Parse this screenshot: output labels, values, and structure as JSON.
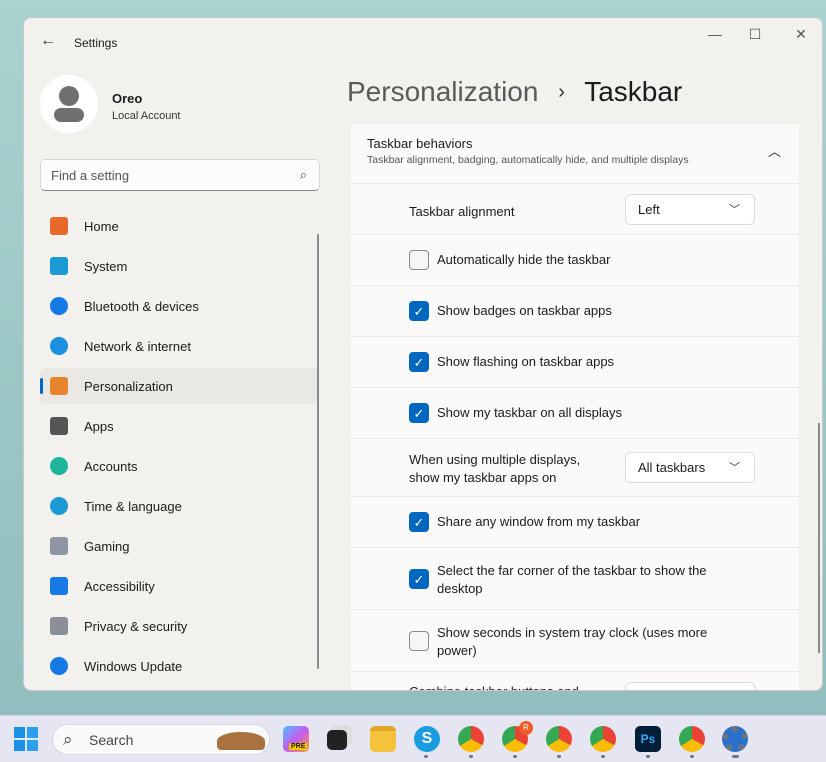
{
  "window": {
    "title": "Settings",
    "minimize": "—",
    "maximize": "☐",
    "close": "✕",
    "back": "←"
  },
  "user": {
    "name": "Oreo",
    "type": "Local Account"
  },
  "search": {
    "placeholder": "Find a setting",
    "icon": "search-icon"
  },
  "sidebar": {
    "selected": "Personalization",
    "items": [
      {
        "label": "Home",
        "icon": "home-icon",
        "color": "#e8692b"
      },
      {
        "label": "System",
        "icon": "system-icon",
        "color": "#1b9ad6"
      },
      {
        "label": "Bluetooth & devices",
        "icon": "bluetooth-icon",
        "color": "#1679e6"
      },
      {
        "label": "Network & internet",
        "icon": "wifi-icon",
        "color": "#1b8fe0"
      },
      {
        "label": "Personalization",
        "icon": "brush-icon",
        "color": "#e8842b"
      },
      {
        "label": "Apps",
        "icon": "apps-icon",
        "color": "#555555"
      },
      {
        "label": "Accounts",
        "icon": "accounts-icon",
        "color": "#1fb59a"
      },
      {
        "label": "Time & language",
        "icon": "globe-clock-icon",
        "color": "#1b9ad6"
      },
      {
        "label": "Gaming",
        "icon": "gamepad-icon",
        "color": "#8e95a3"
      },
      {
        "label": "Accessibility",
        "icon": "accessibility-icon",
        "color": "#1679e6"
      },
      {
        "label": "Privacy & security",
        "icon": "shield-icon",
        "color": "#8a8f98"
      },
      {
        "label": "Windows Update",
        "icon": "update-icon",
        "color": "#1679e6"
      }
    ]
  },
  "breadcrumb": {
    "parent": "Personalization",
    "separator": "›",
    "current": "Taskbar"
  },
  "section": {
    "title": "Taskbar behaviors",
    "subtitle": "Taskbar alignment, badging, automatically hide, and multiple displays",
    "chevron": "chevron-up-icon"
  },
  "settings": [
    {
      "type": "dropdown",
      "label": "Taskbar alignment",
      "value": "Left"
    },
    {
      "type": "checkbox",
      "label": "Automatically hide the taskbar",
      "checked": false
    },
    {
      "type": "checkbox",
      "label": "Show badges on taskbar apps",
      "checked": true
    },
    {
      "type": "checkbox",
      "label": "Show flashing on taskbar apps",
      "checked": true
    },
    {
      "type": "checkbox",
      "label": "Show my taskbar on all displays",
      "checked": true
    },
    {
      "type": "dropdown",
      "label": "When using multiple displays, show my taskbar apps on",
      "value": "All taskbars"
    },
    {
      "type": "checkbox",
      "label": "Share any window from my taskbar",
      "checked": true
    },
    {
      "type": "checkbox",
      "label": "Select the far corner of the taskbar to show the desktop",
      "checked": true
    },
    {
      "type": "checkbox",
      "label": "Show seconds in system tray clock (uses more power)",
      "checked": false
    },
    {
      "type": "dropdown",
      "label": "Combine taskbar buttons and",
      "value": ""
    }
  ],
  "taskbar": {
    "search_label": "Search",
    "copilot_badge": "PRE",
    "apps": [
      "start",
      "search",
      "copilot",
      "task-view",
      "file-explorer",
      "skype",
      "chrome",
      "chrome",
      "chrome",
      "chrome",
      "photoshop",
      "chrome",
      "settings"
    ],
    "photoshop_label": "Ps",
    "skype_label": "S",
    "chrome_badge_r": "R"
  },
  "accent": "#0067c0"
}
